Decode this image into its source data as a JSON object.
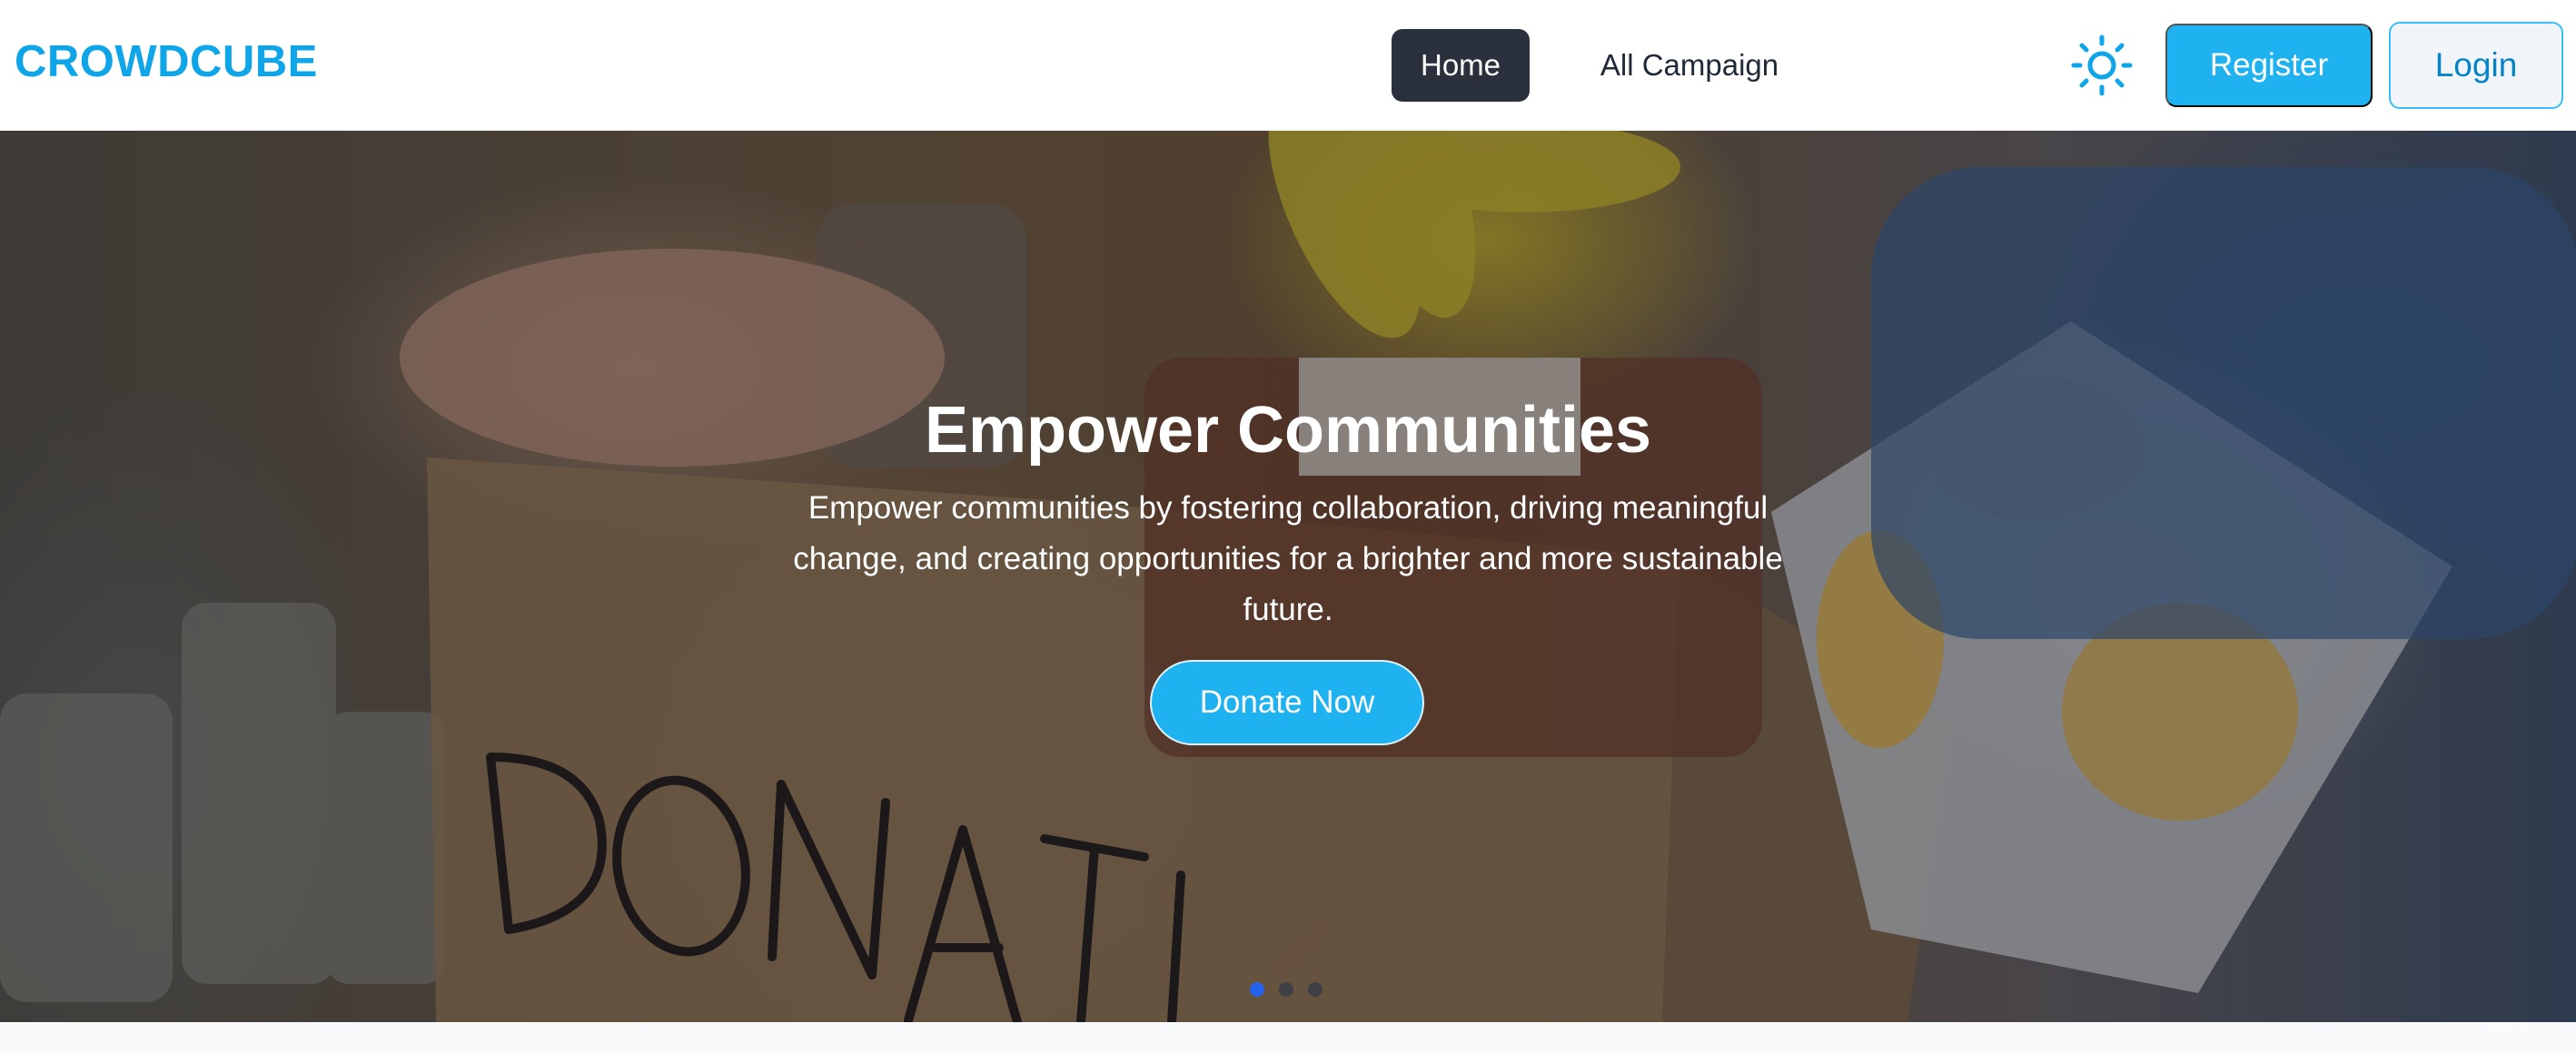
{
  "navbar": {
    "brand": "CROWDCUBE",
    "links": [
      {
        "label": "Home",
        "active": true
      },
      {
        "label": "All Campaign",
        "active": false
      }
    ],
    "theme_icon": "sun-icon",
    "register_label": "Register",
    "login_label": "Login"
  },
  "hero": {
    "title": "Empower Communities",
    "description": "Empower communities by fostering collaboration, driving meaningful change, and creating opportunities for a brighter and more sustainable future.",
    "cta_label": "Donate Now",
    "box_text": "DONATIO",
    "slides": {
      "count": 3,
      "active": 1
    }
  },
  "colors": {
    "brand": "#0ea5e9",
    "primary_button": "#1fb2f0",
    "active_nav": "#2a303c",
    "active_dot": "#2563eb"
  }
}
